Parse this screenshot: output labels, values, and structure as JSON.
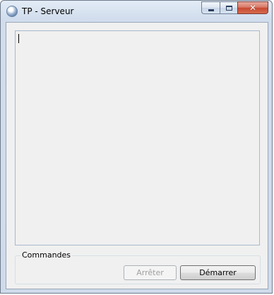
{
  "window": {
    "title": "TP - Serveur"
  },
  "icons": {
    "app": "app-globe-icon",
    "minimize": "minimize-icon",
    "maximize": "maximize-icon",
    "close": "close-icon"
  },
  "log": {
    "value": ""
  },
  "commands": {
    "legend": "Commandes",
    "stop_label": "Arrêter",
    "stop_enabled": false,
    "start_label": "Démarrer",
    "start_enabled": true
  },
  "colors": {
    "close_button": "#c74a33",
    "client_background": "#f0f0f0",
    "disabled_text": "#a0a0a0"
  }
}
